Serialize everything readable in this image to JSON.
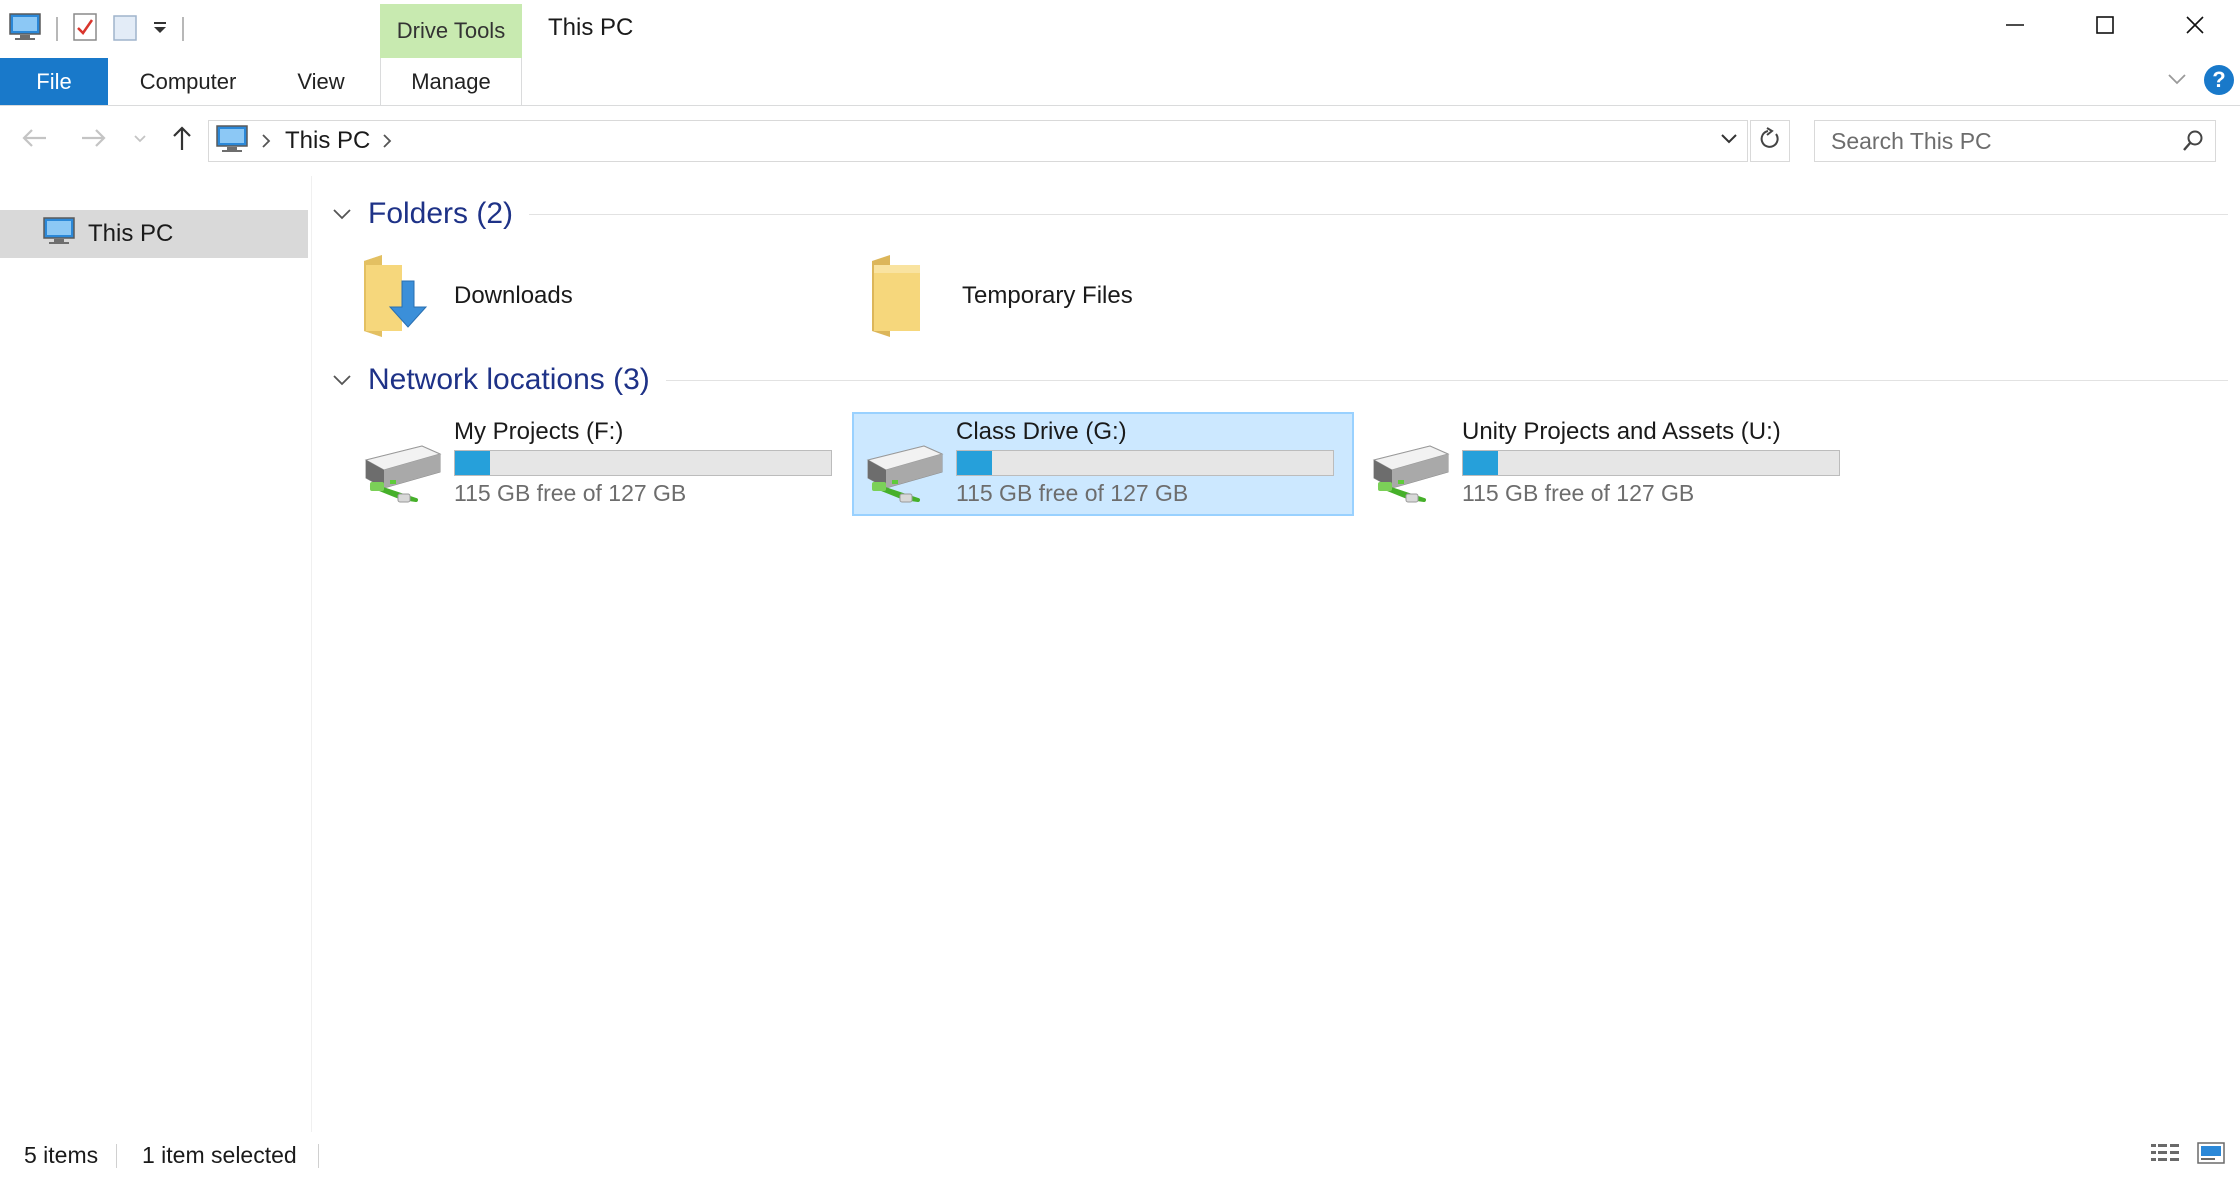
{
  "window": {
    "title": "This PC",
    "contextual_tab_group": "Drive Tools"
  },
  "ribbon": {
    "tabs": [
      {
        "label": "File",
        "active": true
      },
      {
        "label": "Computer"
      },
      {
        "label": "View"
      },
      {
        "label": "Manage"
      }
    ]
  },
  "address": {
    "breadcrumb": [
      "This PC"
    ],
    "search_placeholder": "Search This PC"
  },
  "nav_pane": {
    "items": [
      {
        "label": "This PC",
        "icon": "computer-icon",
        "selected": true
      }
    ]
  },
  "content": {
    "groups": {
      "folders": {
        "title": "Folders (2)",
        "items": [
          {
            "name": "Downloads",
            "icon": "downloads-folder-icon"
          },
          {
            "name": "Temporary Files",
            "icon": "folder-icon"
          }
        ]
      },
      "network": {
        "title": "Network locations (3)",
        "items": [
          {
            "name": "My Projects (F:)",
            "free_text": "115 GB free of 127 GB",
            "used_fraction": 0.094,
            "selected": false,
            "icon": "network-drive-icon"
          },
          {
            "name": "Class Drive (G:)",
            "free_text": "115 GB free of 127 GB",
            "used_fraction": 0.094,
            "selected": true,
            "icon": "network-drive-icon"
          },
          {
            "name": "Unity Projects and Assets (U:)",
            "free_text": "115 GB free of 127 GB",
            "used_fraction": 0.094,
            "selected": false,
            "icon": "network-drive-icon"
          }
        ]
      }
    }
  },
  "status": {
    "item_count": "5 items",
    "selection": "1 item selected"
  },
  "colors": {
    "accent": "#1979ca",
    "drive_tools": "#c8eab0",
    "selection_bg": "#cce8ff",
    "group_title": "#1e3287",
    "usage_fill": "#26a0da"
  }
}
